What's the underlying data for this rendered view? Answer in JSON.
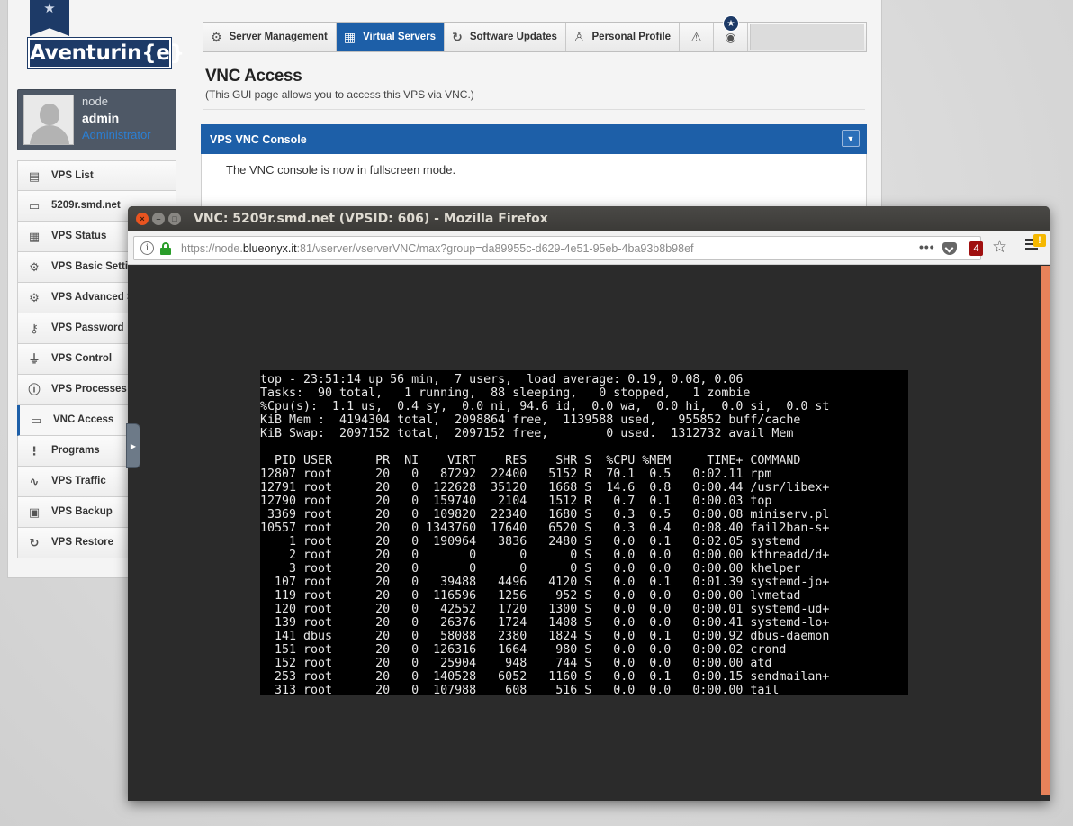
{
  "gui": {
    "logo_text": "Aventurin{e}",
    "logo_star": "★",
    "user": {
      "role_label": "node",
      "name": "admin",
      "group": "Administrator"
    },
    "sidebar": [
      {
        "icon": "list-icon",
        "glyph": "▤",
        "label": "VPS List"
      },
      {
        "icon": "laptop-icon",
        "glyph": "▭",
        "label": "5209r.smd.net"
      },
      {
        "icon": "status-icon",
        "glyph": "▦",
        "label": "VPS Status"
      },
      {
        "icon": "gear-icon",
        "glyph": "⚙",
        "label": "VPS Basic Setti"
      },
      {
        "icon": "gears-icon",
        "glyph": "⚙",
        "label": "VPS Advanced S"
      },
      {
        "icon": "key-icon",
        "glyph": "⚷",
        "label": "VPS Password"
      },
      {
        "icon": "plug-icon",
        "glyph": "⏚",
        "label": "VPS Control"
      },
      {
        "icon": "info-icon",
        "glyph": "ⓘ",
        "label": "VPS Processes"
      },
      {
        "icon": "monitor-icon",
        "glyph": "▭",
        "label": "VNC Access",
        "active": true
      },
      {
        "icon": "sitemap-icon",
        "glyph": "⋮",
        "label": "Programs"
      },
      {
        "icon": "chart-icon",
        "glyph": "∿",
        "label": "VPS Traffic"
      },
      {
        "icon": "backup-icon",
        "glyph": "▣",
        "label": "VPS Backup"
      },
      {
        "icon": "restore-icon",
        "glyph": "↻",
        "label": "VPS Restore"
      }
    ],
    "tabs": [
      {
        "icon": "gear-icon",
        "glyph": "⚙",
        "label": "Server Management"
      },
      {
        "icon": "grid-icon",
        "glyph": "▦",
        "label": "Virtual Servers",
        "active": true
      },
      {
        "icon": "refresh-icon",
        "glyph": "↻",
        "label": "Software Updates"
      },
      {
        "icon": "person-icon",
        "glyph": "♙",
        "label": "Personal Profile"
      },
      {
        "icon": "warning-icon",
        "glyph": "⚠",
        "label": ""
      },
      {
        "icon": "lifebuoy-icon",
        "glyph": "◉",
        "label": ""
      }
    ],
    "tab_badge": "★",
    "page_title": "VNC Access",
    "page_subtitle": "(This GUI page allows you to access this VPS via VNC.)",
    "panel": {
      "title": "VPS VNC Console",
      "toggle": "▼",
      "message": "The VNC console is now in fullscreen mode."
    }
  },
  "firefox": {
    "window_title": "VNC: 5209r.smd.net (VPSID: 606) - Mozilla Firefox",
    "url_prefix": "https://node.",
    "url_domain": "blueonyx.it",
    "url_rest": ":81/vserver/vserverVNC/max?group=da89955c-d629-4e51-95eb-4ba93b8b98ef",
    "page_actions": "•••",
    "ublock_count": "4",
    "bookmark_star": "☆",
    "warning_badge": "!"
  },
  "terminal": {
    "header": [
      "top - 23:51:14 up 56 min,  7 users,  load average: 0.19, 0.08, 0.06",
      "Tasks:  90 total,   1 running,  88 sleeping,   0 stopped,   1 zombie",
      "%Cpu(s):  1.1 us,  0.4 sy,  0.0 ni, 94.6 id,  0.0 wa,  0.0 hi,  0.0 si,  0.0 st",
      "KiB Mem :  4194304 total,  2098864 free,  1139588 used,   955852 buff/cache",
      "KiB Swap:  2097152 total,  2097152 free,        0 used.  1312732 avail Mem"
    ],
    "columns": "  PID USER      PR  NI    VIRT    RES    SHR S  %CPU %MEM     TIME+ COMMAND",
    "rows": [
      "12807 root      20   0   87292  22400   5152 R  70.1  0.5   0:02.11 rpm",
      "12791 root      20   0  122628  35120   1668 S  14.6  0.8   0:00.44 /usr/libex+",
      "12790 root      20   0  159740   2104   1512 R   0.7  0.1   0:00.03 top",
      " 3369 root      20   0  109820  22340   1680 S   0.3  0.5   0:00.08 miniserv.pl",
      "10557 root      20   0 1343760  17640   6520 S   0.3  0.4   0:08.40 fail2ban-s+",
      "    1 root      20   0  190964   3836   2480 S   0.0  0.1   0:02.05 systemd",
      "    2 root      20   0       0      0      0 S   0.0  0.0   0:00.00 kthreadd/d+",
      "    3 root      20   0       0      0      0 S   0.0  0.0   0:00.00 khelper",
      "  107 root      20   0   39488   4496   4120 S   0.0  0.1   0:01.39 systemd-jo+",
      "  119 root      20   0  116596   1256    952 S   0.0  0.0   0:00.00 lvmetad",
      "  120 root      20   0   42552   1720   1300 S   0.0  0.0   0:00.01 systemd-ud+",
      "  139 root      20   0   26376   1724   1408 S   0.0  0.0   0:00.41 systemd-lo+",
      "  141 dbus      20   0   58088   2380   1824 S   0.0  0.1   0:00.92 dbus-daemon",
      "  151 root      20   0  126316   1664    980 S   0.0  0.0   0:00.02 crond",
      "  152 root      20   0   25904    948    744 S   0.0  0.0   0:00.00 atd",
      "  253 root      20   0  140528   6052   1160 S   0.0  0.1   0:00.15 sendmailan+",
      "  313 root      20   0  107988    608    516 S   0.0  0.0   0:00.00 tail"
    ]
  }
}
